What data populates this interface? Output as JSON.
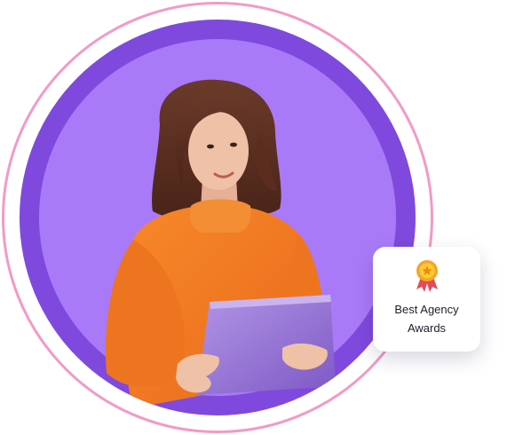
{
  "award_card": {
    "line1": "Best Agency",
    "line2": "Awards",
    "icon": "award-ribbon-icon"
  },
  "colors": {
    "outer_ring": "#f29ac6",
    "purple_ring": "#7f49dd",
    "inner_circle": "#a87af8",
    "sweater": "#f47d1f",
    "tablet": "#9a76d6"
  }
}
